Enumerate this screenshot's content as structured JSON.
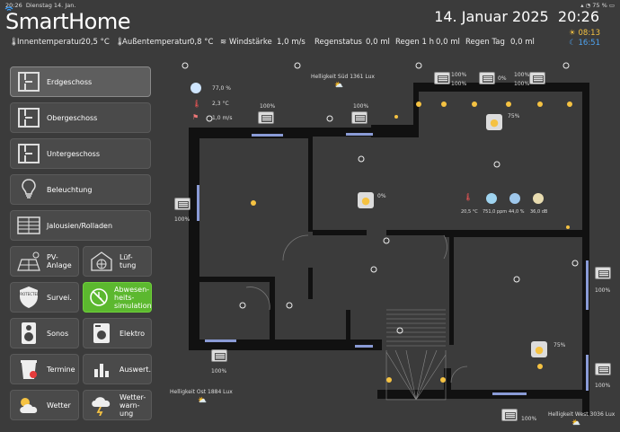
{
  "statusbar": {
    "time": "20:26",
    "date": "Dienstag 14. Jan.",
    "battery": "75 %"
  },
  "header": {
    "logo_a": "Smart",
    "logo_b": "Home",
    "date": "14. Januar 2025",
    "time": "20:26",
    "sunrise": "08:13",
    "moonrise": "16:51"
  },
  "info": {
    "innen_label": "Innentemperatur",
    "innen_value": "20,5 °C",
    "aussen_label": "Außentemperatur",
    "aussen_value": "0,8 °C",
    "wind_label": "Windstärke",
    "wind_value": "1,0 m/s",
    "regen_status_label": "Regenstatus",
    "regen_status_value": "0,0 ml",
    "regen_1h_label": "Regen 1 h",
    "regen_1h_value": "0,0 ml",
    "regen_tag_label": "Regen Tag",
    "regen_tag_value": "0,0 ml"
  },
  "nav": {
    "erdgeschoss": "Erdgeschoss",
    "obergeschoss": "Obergeschoss",
    "untergeschoss": "Untergeschoss",
    "beleuchtung": "Beleuchtung",
    "jalousien": "Jalousien/Rolladen",
    "pv_1": "PV-",
    "pv_2": "Anlage",
    "lueftung_1": "Lüf-",
    "lueftung_2": "tung",
    "survei": "Survei.",
    "abw_1": "Abwesen-",
    "abw_2": "heits-",
    "abw_3": "simulation",
    "sonos": "Sonos",
    "elektro": "Elektro",
    "termine": "Termine",
    "auswert": "Auswert.",
    "wetter": "Wetter",
    "warn_1": "Wetter-",
    "warn_2": "warn-",
    "warn_3": "ung"
  },
  "plan": {
    "hell_sued": "Helligkeit Süd 1361 Lux",
    "hell_ost": "Helligkeit Ost 1884 Lux",
    "hell_west": "Helligkeit West 3036 Lux",
    "weather_humidity": "77,0 %",
    "weather_temp": "2,3 °C",
    "weather_wind": "1,0 m/s",
    "shutters": {
      "s1": "100%",
      "s2": "100%",
      "s3": "100%",
      "s4a": "100%",
      "s4b": "100%",
      "s5": "0%",
      "s6a": "100%",
      "s6b": "100%",
      "s7": "100%",
      "s8": "100%",
      "s9": "100%",
      "s10": "100%",
      "s11": "100%"
    },
    "dimmer_top": "75%",
    "dimmer_mid": "0%",
    "dimmer_right": "75%",
    "room_temp": "20,5 °C",
    "room_co2": "751,0 ppm",
    "room_humidity": "44,0 %",
    "room_noise": "36,0 dB"
  }
}
